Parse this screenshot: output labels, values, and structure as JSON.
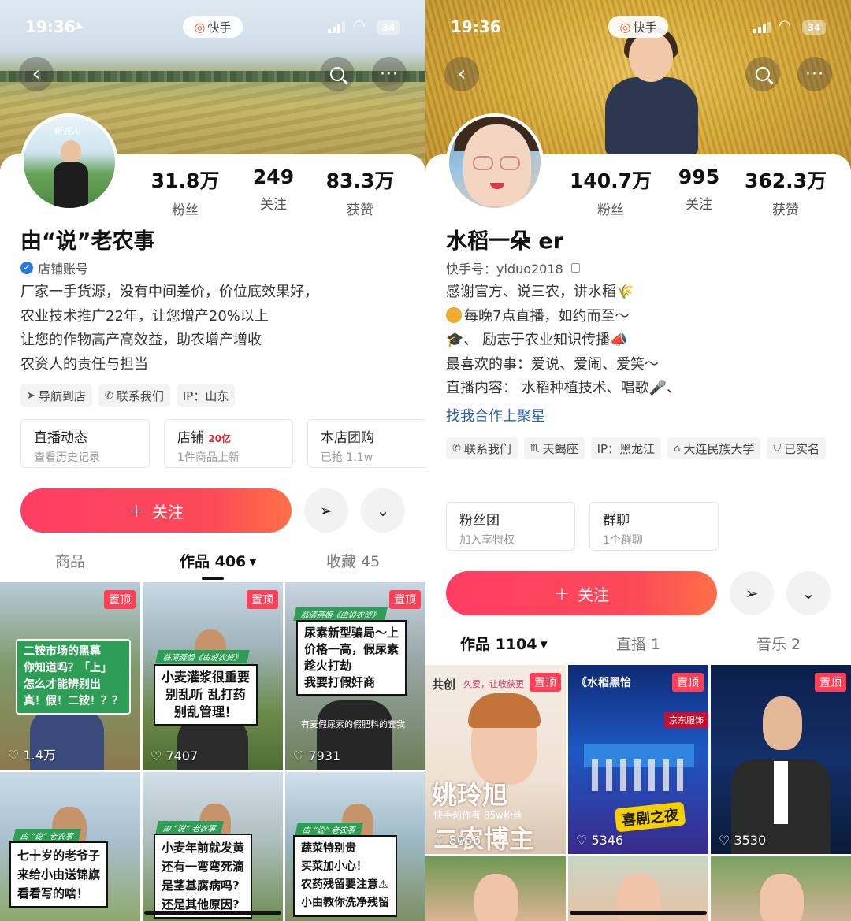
{
  "left": {
    "status": {
      "time": "19:36",
      "battery": "34",
      "brand": "快手"
    },
    "stats": [
      {
        "value": "31.8万",
        "label": "粉丝"
      },
      {
        "value": "249",
        "label": "关注"
      },
      {
        "value": "83.3万",
        "label": "获赞"
      }
    ],
    "avatar_text": "新农人",
    "name": "由“说”老农事",
    "account_type": "店铺账号",
    "bio": [
      "厂家一手货源，没有中间差价，价位底效果好，",
      "农业技术推广22年，让您增产20%以上",
      "让您的作物高产高效益，助农增产增收",
      "农资人的责任与担当"
    ],
    "chips": [
      "导航到店",
      "联系我们",
      "IP：山东"
    ],
    "boxes": [
      {
        "title": "直播动态",
        "badge": "",
        "sub": "查看历史记录"
      },
      {
        "title": "店铺",
        "badge": "20亿",
        "sub": "1件商品上新"
      },
      {
        "title": "本店团购",
        "badge": "",
        "sub": "已抢 1.1w"
      }
    ],
    "follow_label": "关注",
    "tabs": [
      {
        "label": "商品"
      },
      {
        "label": "作品 406"
      },
      {
        "label": "收藏 45"
      }
    ],
    "tiles": [
      {
        "pin": "置顶",
        "likes": "1.4万",
        "caption": [
          "二铵市场的黑幕",
          "你知道吗？「上」",
          "怎么才能辨别出",
          "真！假！二铵！？？"
        ]
      },
      {
        "pin": "置顶",
        "likes": "7407",
        "ribbon": "临清燕姐《由说农资》",
        "caption": [
          "小麦灌浆很重要",
          "别乱听  乱打药",
          "别乱管理！"
        ]
      },
      {
        "pin": "置顶",
        "likes": "7931",
        "ribbon": "临清燕姐《由说农资》",
        "caption": [
          "尿素新型骗局～上",
          "价格一高，假尿素",
          "趁火打劫",
          "我要打假奸商"
        ],
        "subtitle": "有麦假尿素的假肥料的套我"
      },
      {
        "ribbon": "由 “说” 老农事",
        "caption": [
          "七十岁的老爷子",
          "来给小由送锦旗",
          "看看写的啥！"
        ]
      },
      {
        "ribbon": "由 “说” 老农事",
        "caption": [
          "小麦年前就发黄",
          "还有一弯弯死滴",
          "是茎基腐病吗?",
          "还是其他原因?"
        ]
      },
      {
        "ribbon": "由 “说” 老农事",
        "caption": [
          "蔬菜特别贵",
          "买菜加小心！",
          "农药残留要注意⚠",
          "小由教你洗净残留"
        ]
      }
    ]
  },
  "right": {
    "status": {
      "time": "19:36",
      "battery": "34",
      "brand": "快手"
    },
    "stats": [
      {
        "value": "140.7万",
        "label": "粉丝"
      },
      {
        "value": "995",
        "label": "关注"
      },
      {
        "value": "362.3万",
        "label": "获赞"
      }
    ],
    "name": "水稻一朵 er",
    "account_id": "快手号：yiduo2018",
    "bio": [
      "感谢官方、说三农，讲水稻🌾",
      "每晚7点直播，如约而至～",
      "、        励志于农业知识传播📣",
      "最喜欢的事：爱说、爱闹、爱笑～",
      "直播内容：  水稻种植技术、唱歌🎤、"
    ],
    "link": "找我合作上聚星",
    "chips": [
      "联系我们",
      "天蝎座",
      "IP：黑龙江",
      "大连民族大学",
      "已实名"
    ],
    "boxes": [
      {
        "title": "粉丝团",
        "sub": "加入享特权"
      },
      {
        "title": "群聊",
        "sub": "1个群聊"
      }
    ],
    "follow_label": "关注",
    "tabs": [
      {
        "label": "作品 1104"
      },
      {
        "label": "直播 1"
      },
      {
        "label": "音乐 2"
      }
    ],
    "tiles": [
      {
        "pin": "置顶",
        "likes": "8056",
        "corner": "共创",
        "overlay_top": "久爱，让收获更",
        "big": [
          "姚玲旭",
          "二农博主"
        ],
        "small": "快手创作者  85w粉丝"
      },
      {
        "pin": "置顶",
        "likes": "5346",
        "overlay_top": "《水稻黑怡",
        "logo_text": "京东服饰",
        "banner": "喜剧之夜"
      },
      {
        "pin": "置顶",
        "likes": "3530"
      }
    ]
  }
}
